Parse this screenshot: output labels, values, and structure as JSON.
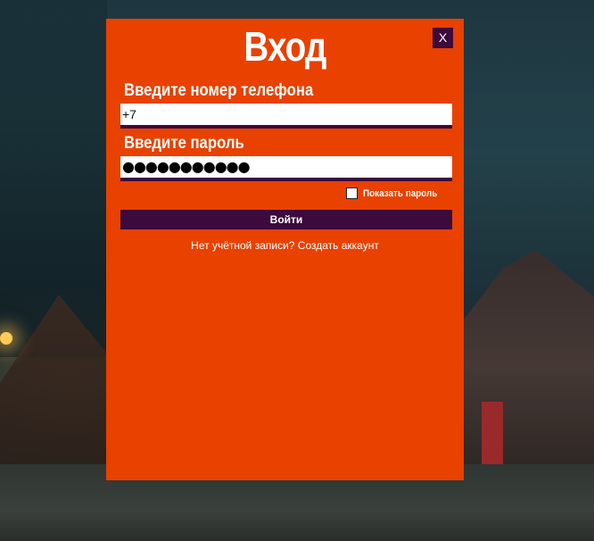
{
  "dialog": {
    "title": "Вход",
    "close_label": "X",
    "phone": {
      "label": "Введите номер телефона",
      "value": "+7"
    },
    "password": {
      "label": "Введите пароль",
      "masked_value": "●●●●●●●●●●●"
    },
    "show_password": {
      "label": "Показать пароль",
      "checked": false
    },
    "login_button": "Войти",
    "register_link": "Нет учётной записи? Создать аккаунт"
  },
  "colors": {
    "dialog_bg": "#e84100",
    "accent_dark": "#3c0a3c",
    "text": "#ffffff"
  }
}
